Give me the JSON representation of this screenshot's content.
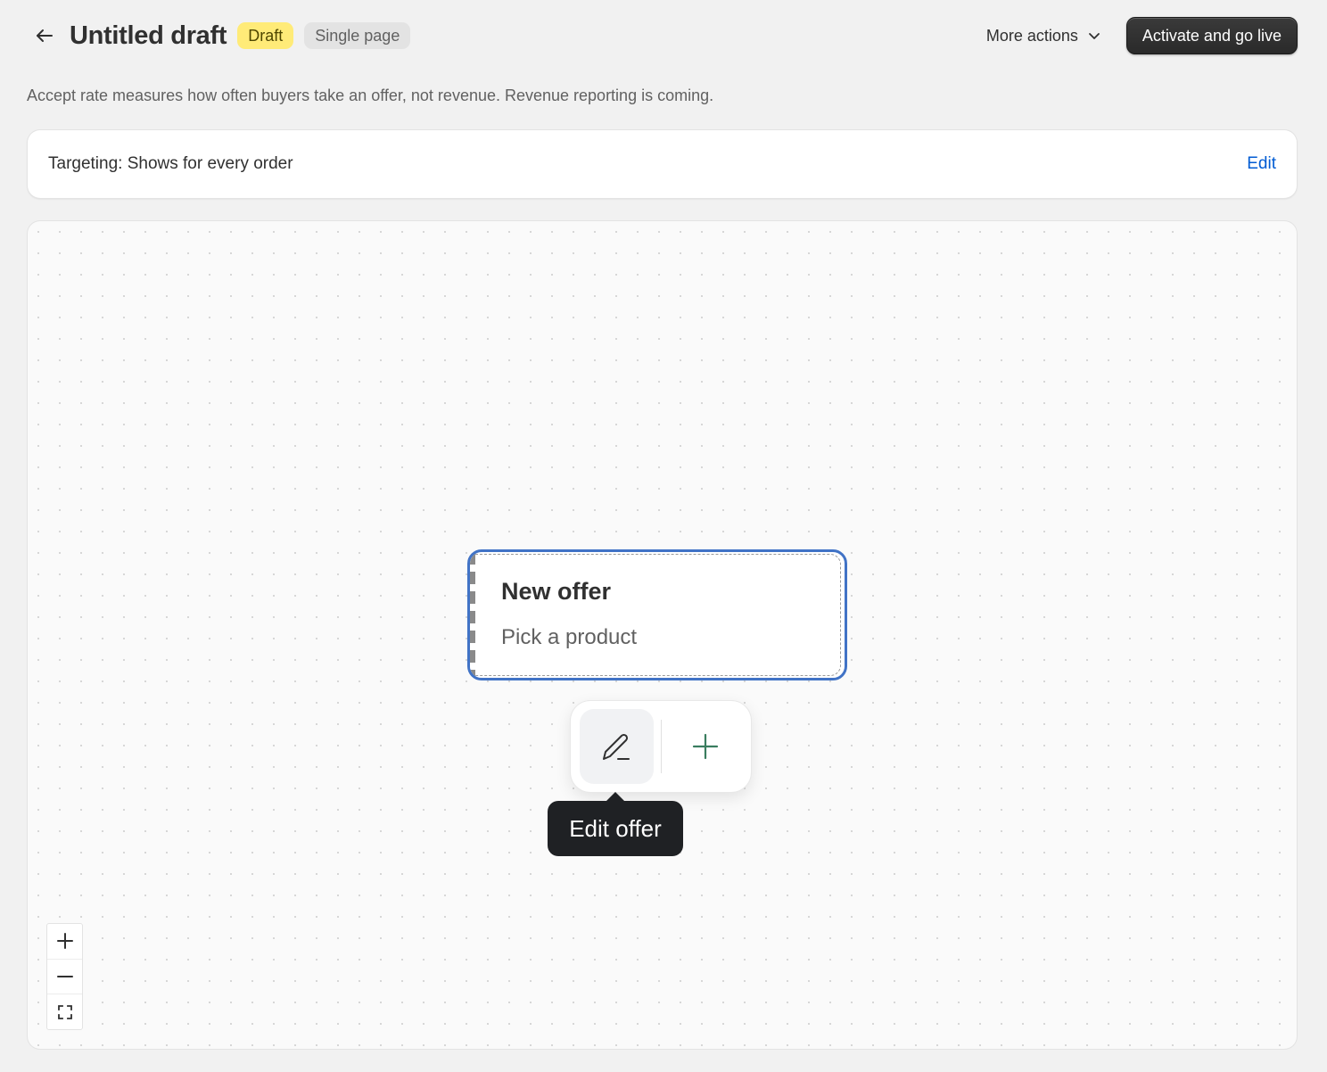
{
  "header": {
    "back_icon": "arrow-left-icon",
    "title": "Untitled draft",
    "status_badge": "Draft",
    "type_badge": "Single page",
    "more_actions_label": "More actions",
    "primary_action_label": "Activate and go live"
  },
  "subtitle": "Accept rate measures how often buyers take an offer, not revenue. Revenue reporting is coming.",
  "targeting": {
    "text": "Targeting: Shows for every order",
    "edit_label": "Edit"
  },
  "canvas": {
    "node": {
      "title": "New offer",
      "subtitle": "Pick a product"
    },
    "toolbar": {
      "edit_icon": "pencil-icon",
      "add_icon": "plus-icon",
      "tooltip": "Edit offer"
    },
    "zoom": {
      "zoom_in_icon": "plus-icon",
      "zoom_out_icon": "minus-icon",
      "fit_icon": "fit-view-icon"
    }
  },
  "colors": {
    "accent_blue": "#4173c6",
    "link_blue": "#005bd3",
    "draft_badge": "#ffeb78",
    "primary_button": "#303030",
    "add_icon_green": "#3a7d5f"
  }
}
